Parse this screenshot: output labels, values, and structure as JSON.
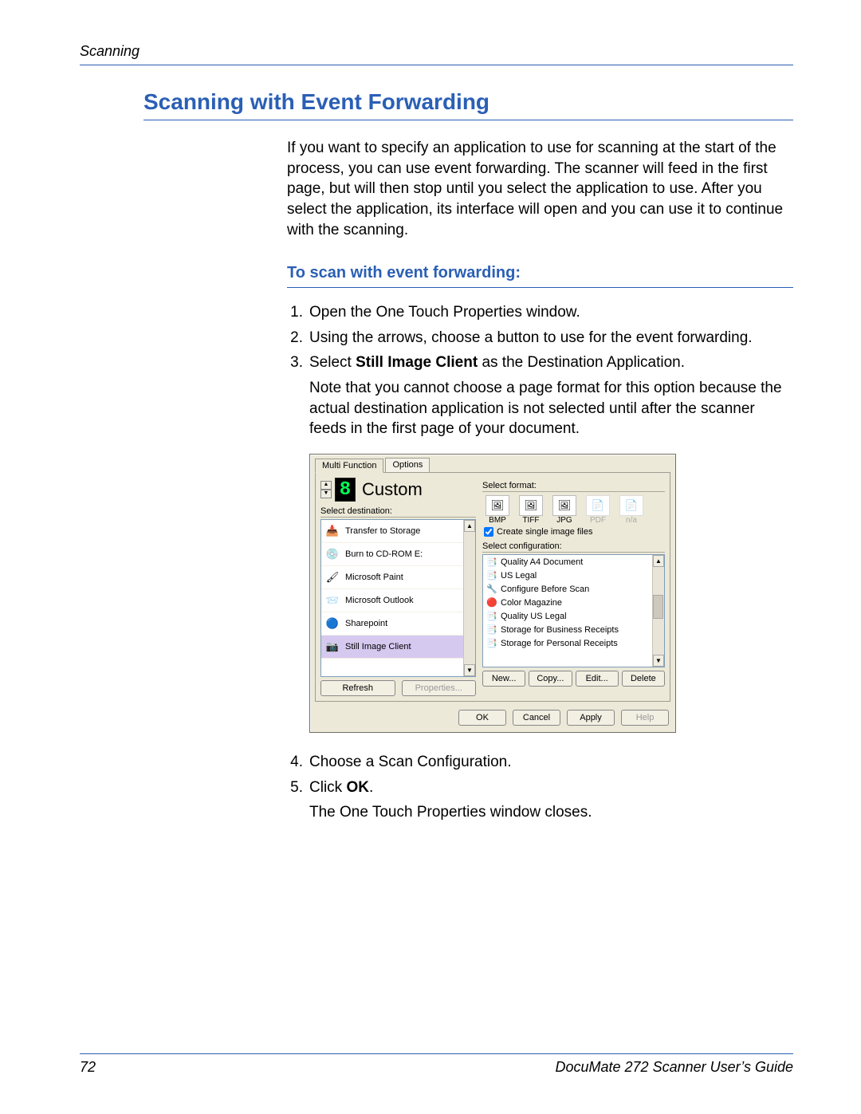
{
  "header": {
    "running": "Scanning"
  },
  "title": "Scanning with Event Forwarding",
  "intro": "If you want to specify an application to use for scanning at the start of the process, you can use event forwarding. The scanner will feed in the first page, but will then stop until you select the application to use. After you select the application, its interface will open and you can use it to continue with the scanning.",
  "subhead": "To scan with event forwarding:",
  "steps": {
    "s1": "Open the One Touch Properties window.",
    "s2": "Using the arrows, choose a button to use for the event forwarding.",
    "s3_pre": "Select ",
    "s3_bold": "Still Image Client",
    "s3_post": " as the Destination Application.",
    "s3_note": "Note that you cannot choose a page format for this option because the actual destination application is not selected until after the scanner feeds in the first page of your document.",
    "s4": "Choose a Scan Configuration.",
    "s5_pre": "Click ",
    "s5_bold": "OK",
    "s5_post": ".",
    "s5_sub": "The One Touch Properties window closes."
  },
  "dialog": {
    "tabs": {
      "t1": "Multi Function",
      "t2": "Options"
    },
    "digit": "8",
    "custom_label": "Custom",
    "labels": {
      "dest": "Select destination:",
      "format": "Select format:",
      "chk": "Create single image files",
      "config": "Select configuration:"
    },
    "destinations": [
      {
        "icon": "📥",
        "label": "Transfer to Storage"
      },
      {
        "icon": "💿",
        "label": "Burn to CD-ROM  E:"
      },
      {
        "icon": "🖌",
        "label": "Microsoft Paint"
      },
      {
        "icon": "📨",
        "label": "Microsoft Outlook"
      },
      {
        "icon": "🔵",
        "label": "Sharepoint"
      },
      {
        "icon": "📷",
        "label": "Still Image Client",
        "selected": true
      }
    ],
    "formats": [
      {
        "code": "BMP",
        "glyph": "🖼"
      },
      {
        "code": "TIFF",
        "glyph": "🖼"
      },
      {
        "code": "JPG",
        "glyph": "🖼"
      },
      {
        "code": "PDF",
        "glyph": "📄",
        "dim": true
      },
      {
        "code": "n/a",
        "glyph": "📄",
        "dim": true
      }
    ],
    "configs": [
      {
        "icon": "📑",
        "label": "Quality A4 Document",
        "lock": "🔒"
      },
      {
        "icon": "📑",
        "label": "US Legal",
        "lock": "🔒"
      },
      {
        "icon": "🔧",
        "label": "Configure Before Scan",
        "lock": "🔒"
      },
      {
        "icon": "🔴",
        "label": "Color Magazine",
        "lock": "🔒"
      },
      {
        "icon": "📑",
        "label": "Quality US Legal",
        "lock": "🔒"
      },
      {
        "icon": "📑",
        "label": "Storage for Business Receipts",
        "lock": ""
      },
      {
        "icon": "📑",
        "label": "Storage for Personal Receipts",
        "lock": ""
      }
    ],
    "buttons": {
      "refresh": "Refresh",
      "properties": "Properties...",
      "new": "New...",
      "copy": "Copy...",
      "edit": "Edit...",
      "delete": "Delete",
      "ok": "OK",
      "cancel": "Cancel",
      "apply": "Apply",
      "help": "Help"
    }
  },
  "footer": {
    "page": "72",
    "guide": "DocuMate 272 Scanner User’s Guide"
  }
}
